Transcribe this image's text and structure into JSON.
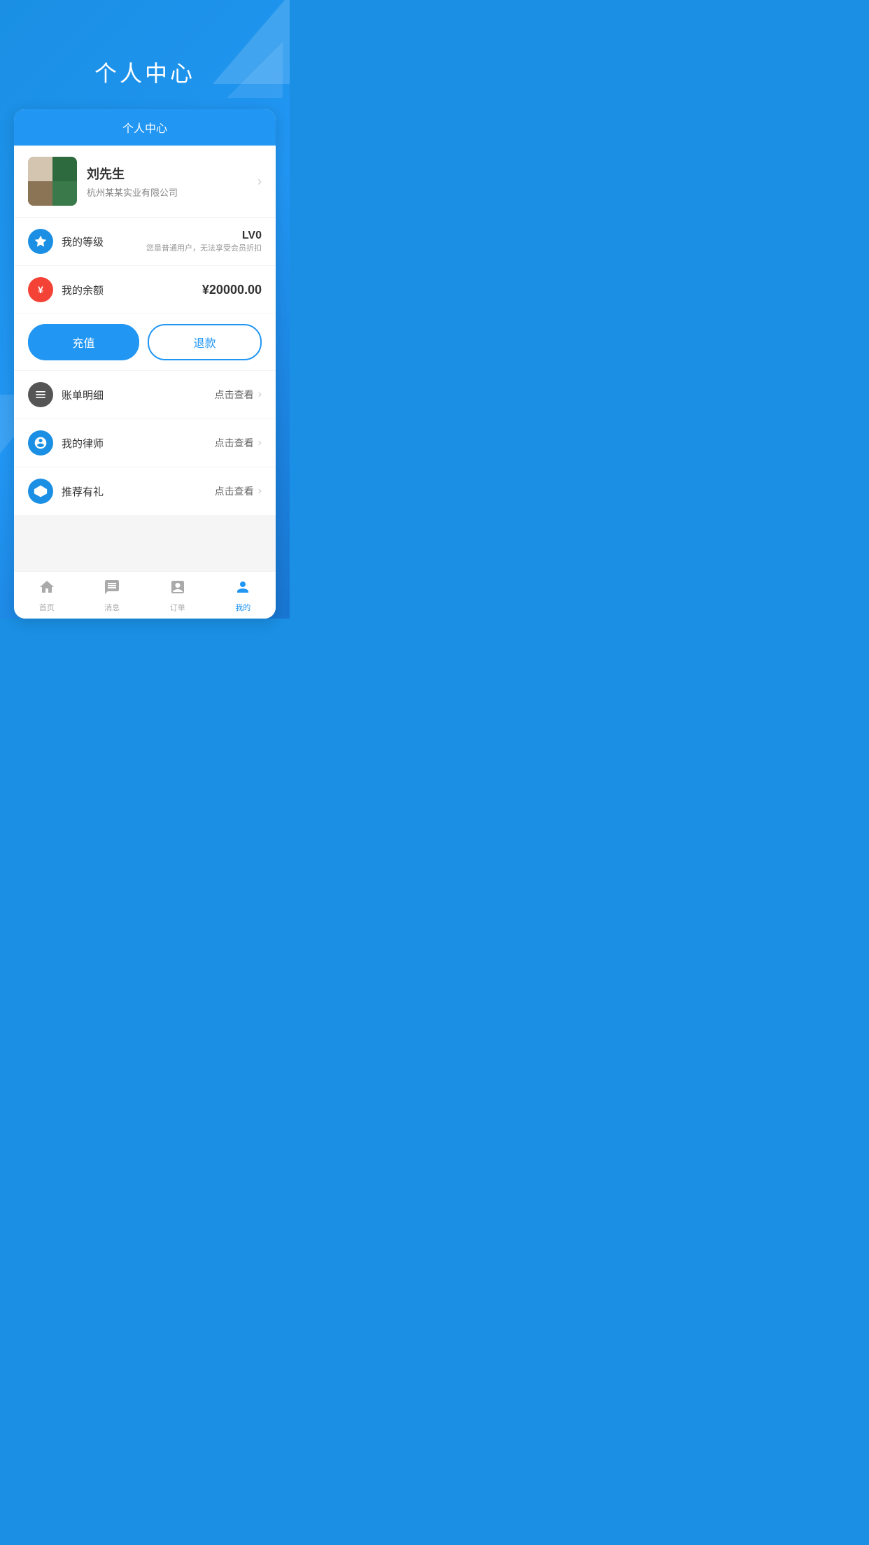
{
  "app": {
    "background_color": "#1a8fe3"
  },
  "page_title": "个人中心",
  "card_header": {
    "title": "个人中心"
  },
  "profile": {
    "name": "刘先生",
    "company": "杭州某某实业有限公司"
  },
  "grade": {
    "label": "我的等级",
    "level": "LV0",
    "description": "您是普通用户，无法享受会员折扣"
  },
  "balance": {
    "label": "我的余额",
    "amount": "¥20000.00",
    "recharge_button": "充值",
    "refund_button": "退款"
  },
  "menu_items": [
    {
      "id": "bill",
      "label": "账单明细",
      "action_text": "点击查看"
    },
    {
      "id": "lawyer",
      "label": "我的律师",
      "action_text": "点击查看"
    },
    {
      "id": "referral",
      "label": "推荐有礼",
      "action_text": "点击查看"
    }
  ],
  "bottom_nav": {
    "items": [
      {
        "id": "home",
        "label": "首页",
        "active": false
      },
      {
        "id": "message",
        "label": "消息",
        "active": false
      },
      {
        "id": "order",
        "label": "订单",
        "active": false
      },
      {
        "id": "mine",
        "label": "我的",
        "active": true
      }
    ]
  }
}
